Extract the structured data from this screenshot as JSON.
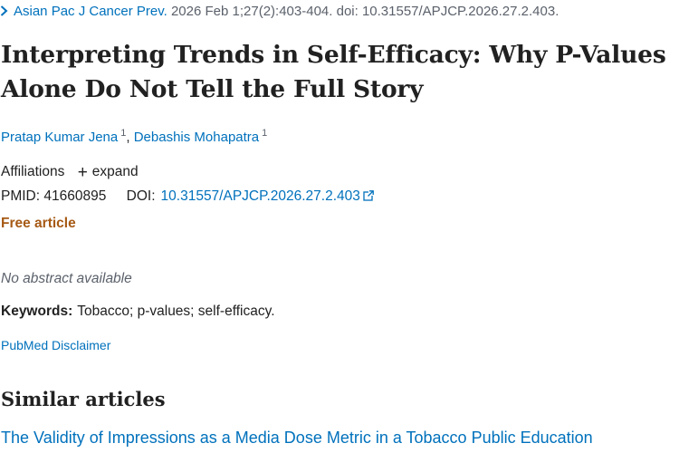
{
  "citation": {
    "journal": "Asian Pac J Cancer Prev.",
    "details": "2026 Feb 1;27(2):403-404. doi: 10.31557/APJCP.2026.27.2.403.",
    "icon": "chevron-right-icon"
  },
  "article": {
    "title": "Interpreting Trends in Self-Efficacy: Why P-Values Alone Do Not Tell the Full Story",
    "authors": [
      {
        "name": "Pratap Kumar Jena",
        "affiliation_num": "1"
      },
      {
        "name": "Debashis Mohapatra",
        "affiliation_num": "1"
      }
    ],
    "author_separator": ",",
    "affiliations_label": "Affiliations",
    "expand_label": "expand",
    "pmid_label": "PMID:",
    "pmid": "41660895",
    "doi_label": "DOI:",
    "doi": "10.31557/APJCP.2026.27.2.403",
    "free_label": "Free article",
    "abstract_status": "No abstract available",
    "keywords_label": "Keywords:",
    "keywords": "Tobacco; p-values; self-efficacy."
  },
  "disclaimer": "PubMed Disclaimer",
  "similar": {
    "heading": "Similar articles",
    "items": [
      {
        "title": "The Validity of Impressions as a Media Dose Metric in a Tobacco Public Education"
      }
    ]
  },
  "colors": {
    "link": "#0071bc",
    "free_article": "#a65a15",
    "muted": "#5b616b",
    "text": "#212121"
  }
}
